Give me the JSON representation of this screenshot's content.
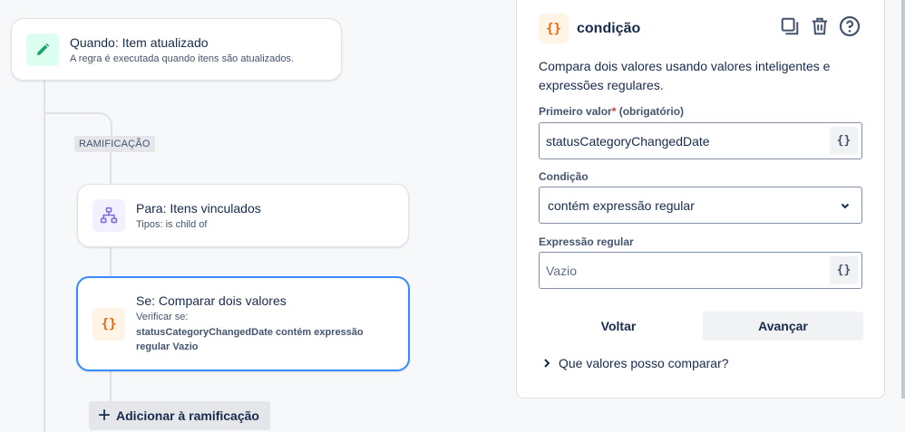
{
  "trigger": {
    "title": "Quando: Item atualizado",
    "subtitle": "A regra é executada quando itens são atualizados.",
    "icon": "pencil-icon",
    "icon_bg": "#dcfff1",
    "icon_color": "#22a06b"
  },
  "branch": {
    "tag": "RAMIFICAÇÃO",
    "add_label": "Adicionar à ramificação"
  },
  "for_card": {
    "title": "Para: Itens vinculados",
    "subtitle": "Tipos: is child of",
    "icon": "hierarchy-icon",
    "icon_bg": "#f3f0ff",
    "icon_color": "#8270db"
  },
  "if_card": {
    "title": "Se: Comparar dois valores",
    "check_label": "Verificar se:",
    "check_detail": "statusCategoryChangedDate contém expressão regular Vazio",
    "icon_text": "{}",
    "icon_bg": "#fff4e5",
    "icon_color": "#e56910"
  },
  "panel": {
    "icon_text": "{}",
    "title": "condição",
    "description": "Compara dois valores usando valores inteligentes e expressões regulares.",
    "first_value": {
      "label": "Primeiro valor",
      "required_mark": "*",
      "optional_note": "(obrigatório)",
      "value": "statusCategoryChangedDate",
      "smart_value_button": "{}"
    },
    "condition": {
      "label": "Condição",
      "selected": "contém expressão regular"
    },
    "regex": {
      "label": "Expressão regular",
      "placeholder": "Vazio",
      "smart_value_button": "{}"
    },
    "back_button": "Voltar",
    "next_button": "Avançar",
    "help_link": "Que valores posso comparar?"
  },
  "colors": {
    "selected_border": "#388bff",
    "required": "#c9372c"
  }
}
